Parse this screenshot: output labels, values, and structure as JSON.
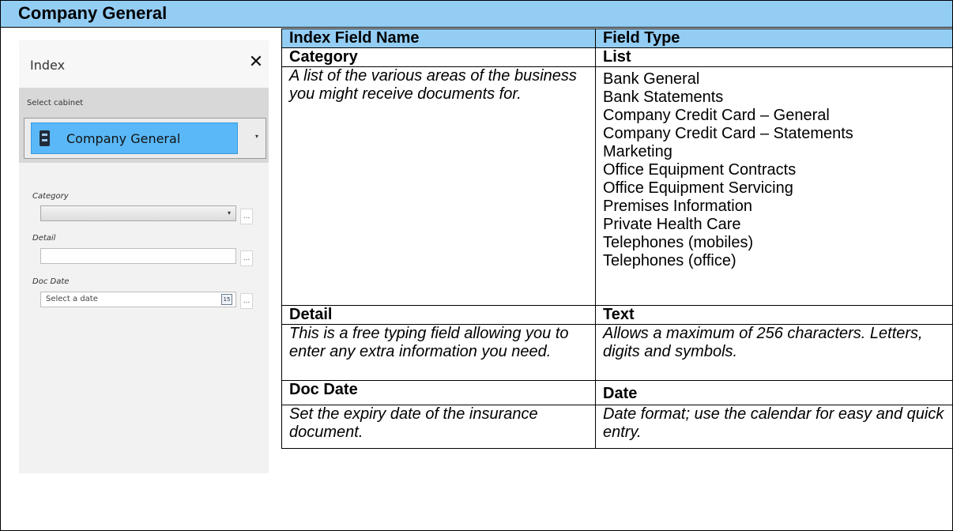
{
  "title": "Company General",
  "panel": {
    "title": "Index",
    "close_icon": "close-icon",
    "select_cabinet_label": "Select cabinet",
    "cabinet_name": "Company General",
    "cabinet_icon": "filing-cabinet-icon",
    "fields": [
      {
        "label": "Category",
        "type": "dropdown",
        "value": "",
        "ellipsis": "..."
      },
      {
        "label": "Detail",
        "type": "text",
        "value": "",
        "ellipsis": "..."
      },
      {
        "label": "Doc Date",
        "type": "date",
        "placeholder": "Select a date",
        "calendar_text": "15",
        "ellipsis": "..."
      }
    ]
  },
  "table": {
    "headers": [
      "Index Field Name",
      "Field Type"
    ],
    "rows": [
      {
        "name": "Category",
        "type": "List",
        "description": "A list of the various areas of the business you might receive documents for.",
        "options": [
          "Bank General",
          "Bank Statements",
          "Company Credit Card – General",
          "Company Credit Card – Statements",
          "Marketing",
          "Office Equipment Contracts",
          "Office Equipment Servicing",
          "Premises Information",
          "Private Health Care",
          "Telephones (mobiles)",
          "Telephones (office)"
        ]
      },
      {
        "name": "Detail",
        "type": "Text",
        "description": "This is a free typing field allowing you to enter any extra information you need.",
        "type_description": "Allows a maximum of 256 characters. Letters, digits and symbols."
      },
      {
        "name": "Doc Date",
        "type": "Date",
        "description": "Set the expiry date of the insurance document.",
        "type_description": "Date format; use the calendar for easy and quick entry."
      }
    ]
  },
  "colors": {
    "header_blue": "#93cdf4",
    "cabinet_blue": "#5ab8f8"
  }
}
